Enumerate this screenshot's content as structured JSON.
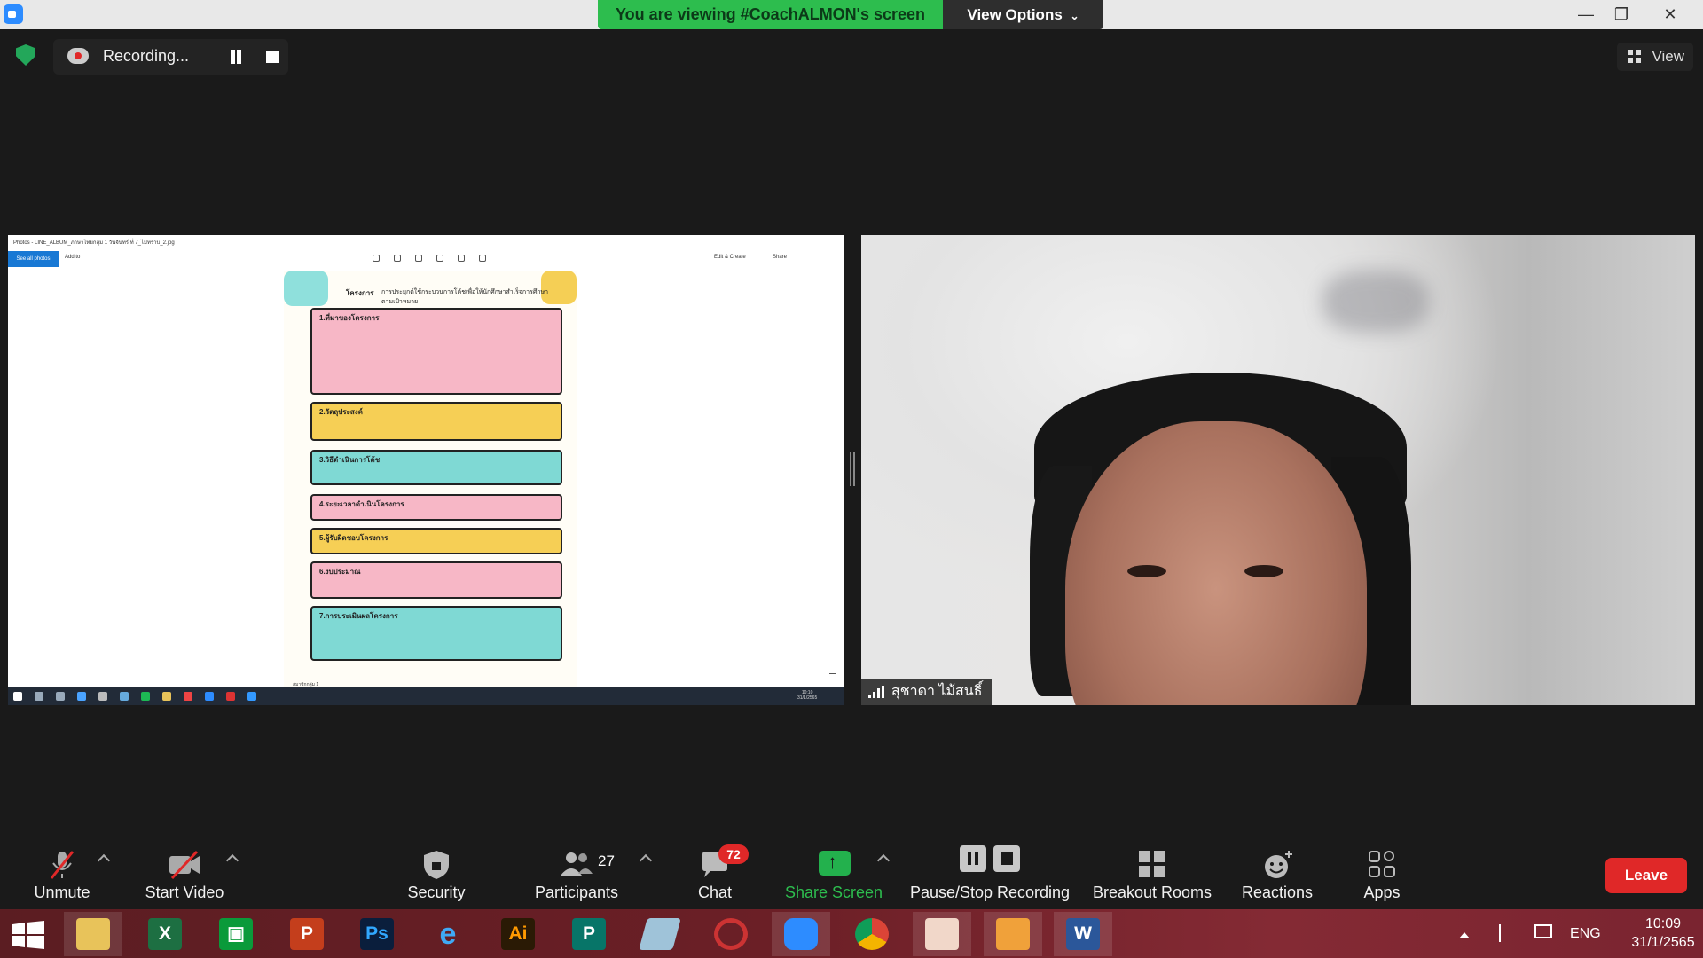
{
  "window": {
    "viewing_banner": "You are viewing #CoachALMON's screen",
    "view_options_label": "View Options",
    "minimize": "—",
    "maximize": "❐",
    "close": "✕"
  },
  "recording": {
    "label": "Recording...",
    "view_label": "View"
  },
  "shared_screen": {
    "window_title": "Photos - LINE_ALBUM_ภาษาไทยกลุ่ม 1 วันจันทร์ ที่ 7_ไม่ทราบ_2.jpg",
    "see_all_photos": "See all photos",
    "add_to": "Add to",
    "edit_create": "Edit & Create",
    "share": "Share",
    "poster": {
      "heading": "โครงการ",
      "subtitle": "การประยุกต์ใช้กระบวนการโค้ชเพื่อให้นักศึกษาสำเร็จการศึกษาตามเป้าหมาย",
      "sections": [
        {
          "title": "1.ที่มาของโครงการ",
          "color": "#f7b7c6"
        },
        {
          "title": "2.วัตถุประสงค์",
          "color": "#f6cf55"
        },
        {
          "title": "3.วิธีดำเนินการโค้ช",
          "color": "#7fd9d4"
        },
        {
          "title": "4.ระยะเวลาดำเนินโครงการ",
          "color": "#f7b7c6"
        },
        {
          "title": "5.ผู้รับผิดชอบโครงการ",
          "color": "#f6cf55"
        },
        {
          "title": "6.งบประมาณ",
          "color": "#f7b7c6"
        },
        {
          "title": "7.การประเมินผลโครงการ",
          "color": "#7fd9d4"
        }
      ],
      "footer": "สมาชิกกลุ่ม 1"
    },
    "clock_time": "10:10",
    "clock_date": "31/1/2565"
  },
  "participant": {
    "name": "สุชาดา ไม้สนธิ์"
  },
  "toolbar": {
    "unmute": "Unmute",
    "start_video": "Start Video",
    "security": "Security",
    "participants": "Participants",
    "participants_count": "27",
    "chat": "Chat",
    "chat_badge": "72",
    "share_screen": "Share Screen",
    "pause_stop_recording": "Pause/Stop Recording",
    "breakout_rooms": "Breakout Rooms",
    "reactions": "Reactions",
    "apps": "Apps",
    "leave": "Leave",
    "share_screen_color": "#23b14d",
    "leave_color": "#e02828"
  },
  "taskbar": {
    "apps": [
      "start-icon",
      "file-explorer-icon",
      "excel-icon",
      "store-icon",
      "powerpoint-icon",
      "photoshop-icon",
      "internet-explorer-icon",
      "illustrator-icon",
      "publisher-icon",
      "notepad-icon",
      "hotcape-icon",
      "zoom-icon",
      "chrome-icon",
      "photos-icon",
      "camera-icon",
      "word-icon"
    ],
    "language": "ENG",
    "time": "10:09",
    "date": "31/1/2565"
  }
}
